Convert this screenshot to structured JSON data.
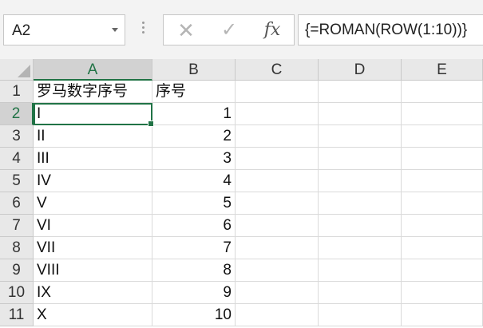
{
  "name_box": {
    "value": "A2"
  },
  "formula_bar": {
    "cancel_icon": "close-icon",
    "enter_icon": "check-icon",
    "function_label": "fx",
    "formula": "{=ROMAN(ROW(1:10))}"
  },
  "columns": [
    "A",
    "B",
    "C",
    "D",
    "E"
  ],
  "selected_cell": "A2",
  "rows": [
    {
      "num": "1",
      "a": "罗马数字序号",
      "b": "序号"
    },
    {
      "num": "2",
      "a": "I",
      "b": "1"
    },
    {
      "num": "3",
      "a": "II",
      "b": "2"
    },
    {
      "num": "4",
      "a": "III",
      "b": "3"
    },
    {
      "num": "5",
      "a": "IV",
      "b": "4"
    },
    {
      "num": "6",
      "a": "V",
      "b": "5"
    },
    {
      "num": "7",
      "a": "VI",
      "b": "6"
    },
    {
      "num": "8",
      "a": "VII",
      "b": "7"
    },
    {
      "num": "9",
      "a": "VIII",
      "b": "8"
    },
    {
      "num": "10",
      "a": "IX",
      "b": "9"
    },
    {
      "num": "11",
      "a": "X",
      "b": "10"
    }
  ],
  "colors": {
    "accent": "#217346",
    "header_bg": "#e8e8e8",
    "gridline": "#dadada"
  }
}
